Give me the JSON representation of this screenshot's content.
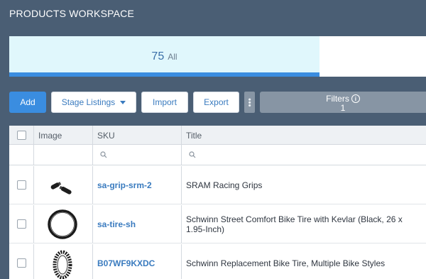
{
  "header": {
    "title": "PRODUCTS WORKSPACE"
  },
  "summary": {
    "count": "75",
    "label": "All"
  },
  "toolbar": {
    "add_label": "Add",
    "stage_label": "Stage Listings",
    "import_label": "Import",
    "export_label": "Export",
    "filters_label": "Filters",
    "filters_count": "1"
  },
  "table": {
    "columns": [
      "Image",
      "SKU",
      "Title"
    ],
    "rows": [
      {
        "sku": "sa-grip-srm-2",
        "title": "SRAM Racing Grips",
        "image": "bike-grips"
      },
      {
        "sku": "sa-tire-sh",
        "title": "Schwinn Street Comfort Bike Tire with Kevlar (Black, 26 x 1.95-Inch)",
        "image": "street-tire"
      },
      {
        "sku": "B07WF9KXDC",
        "title": "Schwinn Replacement Bike Tire, Multiple Bike Styles",
        "image": "knobby-tire"
      }
    ]
  },
  "colors": {
    "accent": "#3a8de0",
    "background": "#4a5e74",
    "link": "#3a7bbf"
  }
}
